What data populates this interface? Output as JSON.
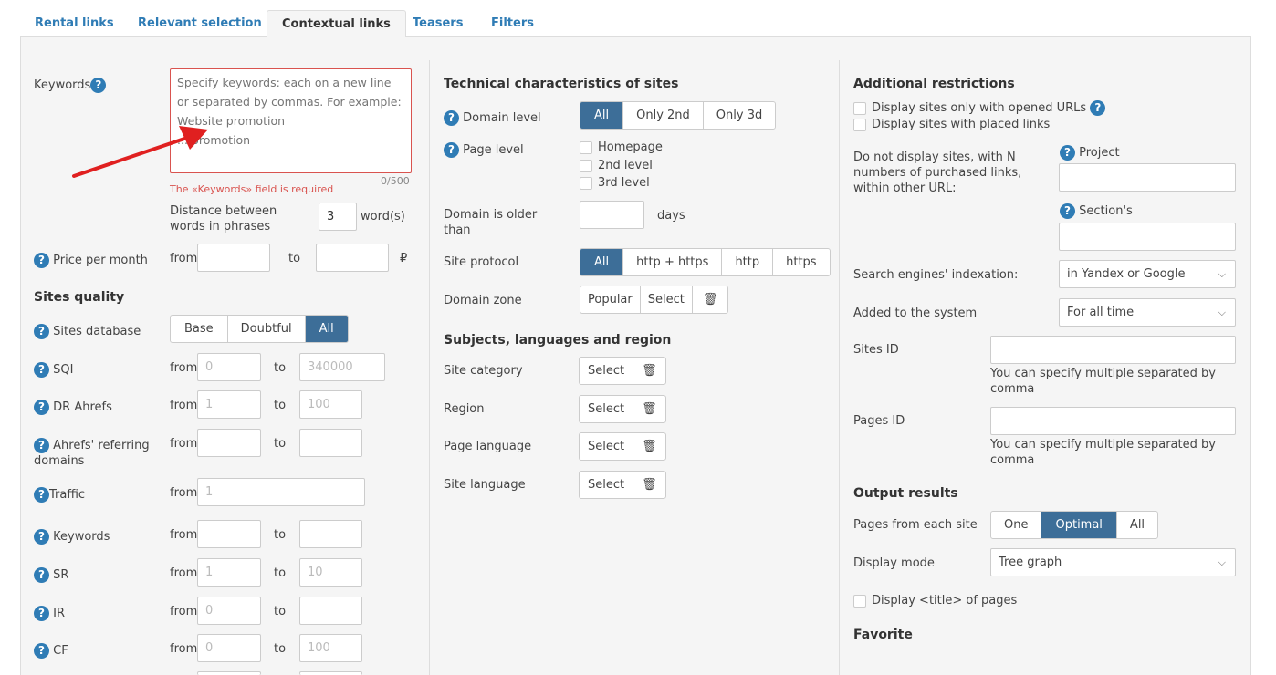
{
  "tabs": [
    "Rental links",
    "Relevant selection",
    "Contextual links",
    "Teasers",
    "Filters"
  ],
  "left": {
    "keywords_label": "Keywords",
    "keywords_placeholder": "Specify keywords: each on a new line or separated by commas. For example:\nWebsite promotion\n... promotion",
    "keywords_counter": "0/500",
    "keywords_error": "The «Keywords» field is required",
    "distance_label": "Distance between words in phrases",
    "distance_value": "3",
    "distance_unit": "word(s)",
    "price_label": "Price per month",
    "from": "from",
    "to": "to",
    "currency": "₽",
    "sites_quality_title": "Sites quality",
    "sites_database_label": "Sites database",
    "sites_database_options": [
      "Base",
      "Doubtful",
      "All"
    ],
    "sqi_label": "SQI",
    "sqi_from": "0",
    "sqi_to": "340000",
    "dr_label": "DR Ahrefs",
    "dr_from": "1",
    "dr_to": "100",
    "ahrefs_ref_label": "Ahrefs' referring domains",
    "traffic_label": "Traffic",
    "traffic_from": "1",
    "keywords2_label": "Keywords",
    "sr_label": "SR",
    "sr_from": "1",
    "sr_to": "10",
    "ir_label": "IR",
    "ir_from": "0",
    "cf_label": "CF",
    "cf_from": "0",
    "cf_to": "100"
  },
  "middle": {
    "tech_title": "Technical characteristics of sites",
    "domain_level_label": "Domain level",
    "domain_level_options": [
      "All",
      "Only 2nd",
      "Only 3d"
    ],
    "page_level_label": "Page level",
    "page_level_options": [
      "Homepage",
      "2nd level",
      "3rd level"
    ],
    "domain_older_label": "Domain is older than",
    "days": "days",
    "protocol_label": "Site protocol",
    "protocol_options": [
      "All",
      "http + https",
      "http",
      "https"
    ],
    "zone_label": "Domain zone",
    "zone_options": [
      "Popular",
      "Select"
    ],
    "subjects_title": "Subjects, languages and region",
    "site_category_label": "Site category",
    "region_label": "Region",
    "page_language_label": "Page language",
    "site_language_label": "Site language",
    "select": "Select"
  },
  "right": {
    "additional_title": "Additional restrictions",
    "opened_urls": "Display sites only with opened URLs",
    "placed_links": "Display sites with placed links",
    "not_display_label": "Do not display sites, with N numbers of purchased links, within other URL:",
    "project_label": "Project",
    "sections_label": "Section's",
    "indexation_label": "Search engines' indexation:",
    "indexation_value": "in Yandex or Google",
    "added_label": "Added to the system",
    "added_value": "For all time",
    "sites_id_label": "Sites ID",
    "sites_id_hint": "You can specify multiple separated by comma",
    "pages_id_label": "Pages ID",
    "pages_id_hint": "You can specify multiple separated by comma",
    "output_title": "Output results",
    "pages_each_label": "Pages from each site",
    "pages_each_options": [
      "One",
      "Optimal",
      "All"
    ],
    "display_mode_label": "Display mode",
    "display_mode_value": "Tree graph",
    "display_title": "Display <title> of pages",
    "favorite_title": "Favorite"
  },
  "colors": {
    "accent": "#2f7cb5",
    "active_btn": "#3d6e98",
    "error": "#d9534f",
    "arrow": "#e02020"
  }
}
